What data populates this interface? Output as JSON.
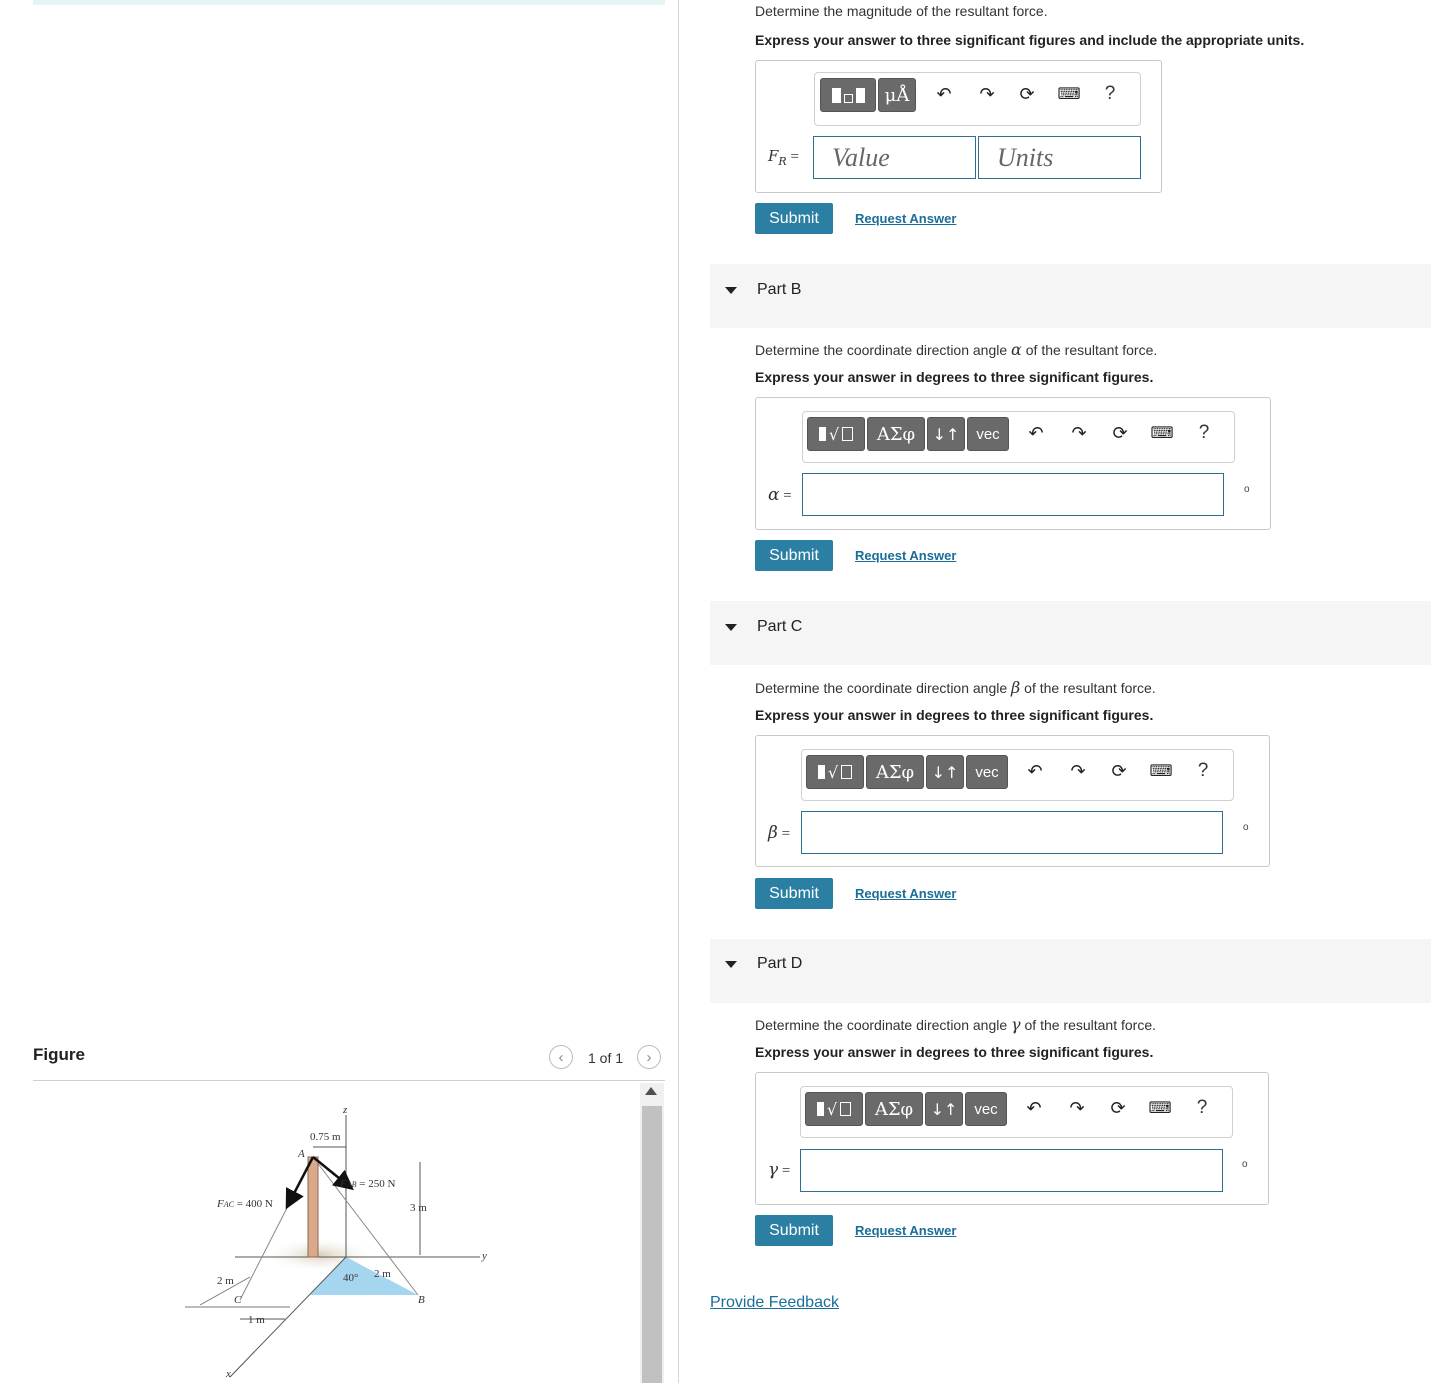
{
  "figure": {
    "title": "Figure",
    "pager": "1 of 1",
    "labels": {
      "z": "z",
      "y": "y",
      "x": "x",
      "A": "A",
      "B": "B",
      "C": "C",
      "dim_075": "0.75 m",
      "fab": "F",
      "fab_sub": "AB",
      "fab_val": " = 250 N",
      "fac": "F",
      "fac_sub": "AC",
      "fac_val": " = 400 N",
      "dim_3m": "3 m",
      "dim_2m_left": "2 m",
      "dim_1m": "1 m",
      "angle": "40°",
      "dim_2m_b": "2 m"
    }
  },
  "partA": {
    "prompt": "Determine the magnitude of the resultant force.",
    "instruction": "Express your answer to three significant figures and include the appropriate units.",
    "label": "F",
    "label_sub": "R",
    "label_eq": " =",
    "value_placeholder": "Value",
    "units_placeholder": "Units",
    "tb_units": "μÅ",
    "help": "?",
    "submit": "Submit",
    "request": "Request Answer"
  },
  "partB": {
    "title": "Part B",
    "prompt_pre": "Determine the coordinate direction angle ",
    "symbol": "α",
    "prompt_post": " of the resultant force.",
    "instruction": "Express your answer in degrees to three significant figures.",
    "label_eq": " =",
    "greek_btn": "ΑΣφ",
    "arrows_btn": "↓↑",
    "vec_btn": "vec",
    "help": "?",
    "unit": "o",
    "submit": "Submit",
    "request": "Request Answer"
  },
  "partC": {
    "title": "Part C",
    "prompt_pre": "Determine the coordinate direction angle ",
    "symbol": "β",
    "prompt_post": " of the resultant force.",
    "instruction": "Express your answer in degrees to three significant figures.",
    "label_eq": " =",
    "greek_btn": "ΑΣφ",
    "arrows_btn": "↓↑",
    "vec_btn": "vec",
    "help": "?",
    "unit": "o",
    "submit": "Submit",
    "request": "Request Answer"
  },
  "partD": {
    "title": "Part D",
    "prompt_pre": "Determine the coordinate direction angle ",
    "symbol": "γ",
    "prompt_post": " of the resultant force.",
    "instruction": "Express your answer in degrees to three significant figures.",
    "label_eq": " =",
    "greek_btn": "ΑΣφ",
    "arrows_btn": "↓↑",
    "vec_btn": "vec",
    "help": "?",
    "unit": "o",
    "submit": "Submit",
    "request": "Request Answer"
  },
  "feedback": "Provide Feedback"
}
